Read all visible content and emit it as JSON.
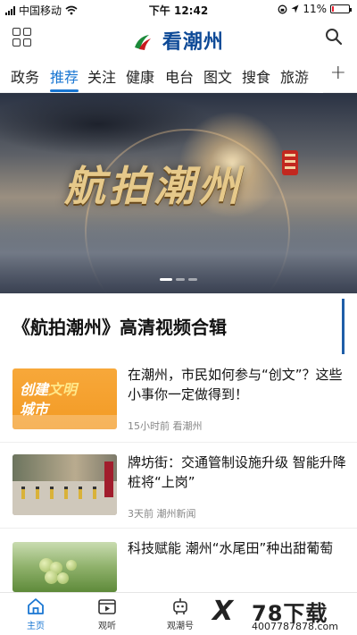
{
  "status_bar": {
    "carrier": "中国移动",
    "time": "下午 12:42",
    "battery_percent": "11%",
    "battery_level": 0.11
  },
  "header": {
    "logo_text": "看潮州",
    "menu_icon": "grid-icon",
    "search_icon": "search-icon"
  },
  "tabs": [
    {
      "label": "政务",
      "active": false
    },
    {
      "label": "推荐",
      "active": true
    },
    {
      "label": "关注",
      "active": false
    },
    {
      "label": "健康",
      "active": false
    },
    {
      "label": "电台",
      "active": false
    },
    {
      "label": "图文",
      "active": false
    },
    {
      "label": "搜食",
      "active": false
    },
    {
      "label": "旅游",
      "active": false
    }
  ],
  "tab_add_label": "+",
  "banner": {
    "title": "航拍潮州",
    "seal_text": "潮州",
    "slide_count": 3,
    "active_slide": 0
  },
  "section": {
    "title": "《航拍潮州》高清视频合辑"
  },
  "news": [
    {
      "headline": "在潮州，市民如何参与“创文”？这些小事你一定做得到！",
      "time": "15小时前",
      "source": "看潮州",
      "thumb_text_1": "创建",
      "thumb_text_1b": "文明",
      "thumb_text_2": "城市"
    },
    {
      "headline": "牌坊街：交通管制设施升级 智能升降桩将“上岗”",
      "time": "3天前",
      "source": "潮州新闻"
    },
    {
      "headline": "科技赋能 潮州“水尾田”种出甜葡萄",
      "time": "",
      "source": ""
    }
  ],
  "bottom_nav": [
    {
      "label": "主页",
      "icon": "home-icon",
      "active": true
    },
    {
      "label": "观听",
      "icon": "video-icon",
      "active": false
    },
    {
      "label": "观潮号",
      "icon": "robot-icon",
      "active": false
    }
  ],
  "watermark": {
    "logo": "X",
    "name": "78下载",
    "url": "4007787878.com"
  },
  "colors": {
    "accent": "#1976d2",
    "logo_blue": "#0e4a97",
    "logo_red": "#c8191f",
    "section_bar": "#1f5ea8"
  }
}
